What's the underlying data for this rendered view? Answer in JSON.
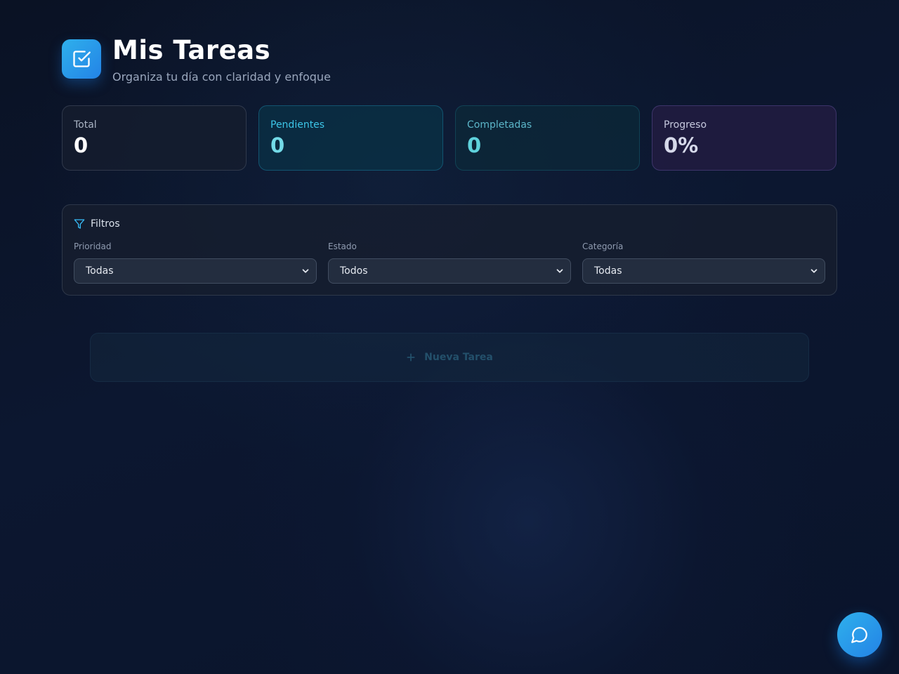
{
  "header": {
    "title": "Mis Tareas",
    "subtitle": "Organiza tu día con claridad y enfoque",
    "logo_icon": "checkbox-icon"
  },
  "stats": [
    {
      "label": "Total",
      "value": "0"
    },
    {
      "label": "Pendientes",
      "value": "0"
    },
    {
      "label": "Completadas",
      "value": "0"
    },
    {
      "label": "Progreso",
      "value": "0%"
    }
  ],
  "filters": {
    "title": "Filtros",
    "icon": "filter-icon",
    "priority": {
      "label": "Prioridad",
      "selected": "Todas"
    },
    "status": {
      "label": "Estado",
      "selected": "Todos"
    },
    "category": {
      "label": "Categoría",
      "selected": "Todas"
    }
  },
  "new_task": {
    "label": "Nueva Tarea",
    "icon": "plus-icon"
  },
  "chat": {
    "icon": "chat-bubble-icon"
  },
  "colors": {
    "accent": "#2b9fea",
    "pending": "#3cc6e8",
    "completed": "#5fd2dc",
    "progress": "#d6d9ea",
    "background": "#0b1428"
  }
}
